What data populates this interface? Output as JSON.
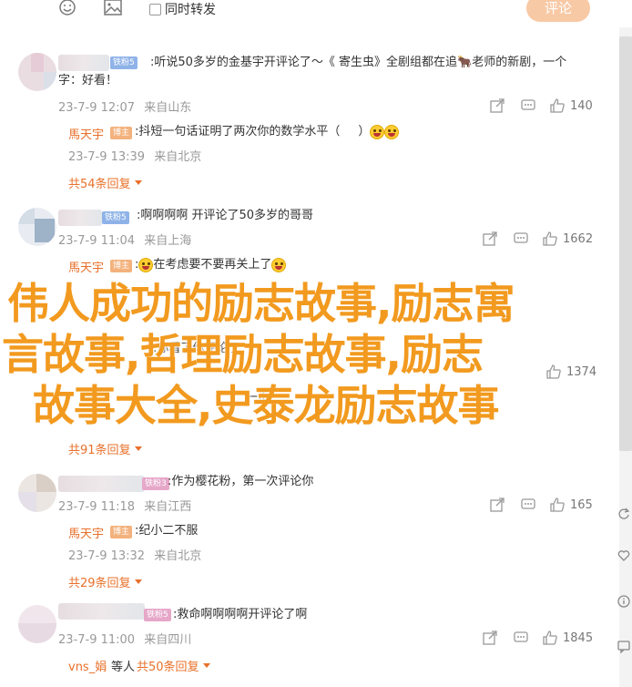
{
  "toolbar": {
    "emoji_icon": "smile-icon",
    "image_icon": "image-icon",
    "forward_label": "同时转发",
    "post_label": "评论"
  },
  "comments": [
    {
      "badge": "铁粉5",
      "text_line1": ":听说50多岁的金基宇开评论了～《 寄生虫》全剧组都在追🐂老师的新剧，一个",
      "text_line2": "字：好看！",
      "date": "23-7-9 12:07",
      "location": "来自山东",
      "likes": "140",
      "reply": {
        "name": "馬天宇",
        "badge": "博主",
        "text": ":抖短一句话证明了两次你的数学水平（",
        "text_tail": "）",
        "date": "23-7-9 13:39",
        "location": "来自北京"
      },
      "more": "共54条回复"
    },
    {
      "badge": "铁粉5",
      "text_line1": ":啊啊啊啊 开评论了50多岁的哥哥",
      "date": "23-7-9 11:04",
      "location": "来自上海",
      "likes": "1662",
      "reply": {
        "name": "馬天宇",
        "badge": "博主",
        "text": ":",
        "text_tail": "在考虑要不要再关上了",
        "date": "",
        "location": ""
      }
    },
    {
      "text_line1": ":你看了你评论了",
      "text_tail": "一页",
      "likes": "1374",
      "more": "共91条回复"
    },
    {
      "badge": "铁粉3",
      "text_line1": ":作为樱花粉，第一次评论你",
      "date": "23-7-9 11:18",
      "location": "来自江西",
      "likes": "165",
      "reply": {
        "name": "馬天宇",
        "badge": "博主",
        "text": ":纪小二不服",
        "date": "23-7-9 13:32",
        "location": "来自北京"
      },
      "more": "共29条回复"
    },
    {
      "badge": "铁粉5",
      "text_line1": ":救命啊啊啊啊开评论了啊",
      "date": "23-7-9 11:00",
      "location": "来自四川",
      "likes": "1845",
      "reply_name_partial": "vns_娟",
      "reply_suffix": "等人",
      "more": "共50条回复"
    }
  ],
  "overlay": {
    "line1": "伟人成功的励志故事,励志寓",
    "line2": "言故事,哲理励志故事,励志",
    "line3": "故事大全,史泰龙励志故事"
  },
  "colors": {
    "accent": "#e8702a",
    "overlay_text": "#f29a1f",
    "post_button": "#f8c9a5"
  }
}
